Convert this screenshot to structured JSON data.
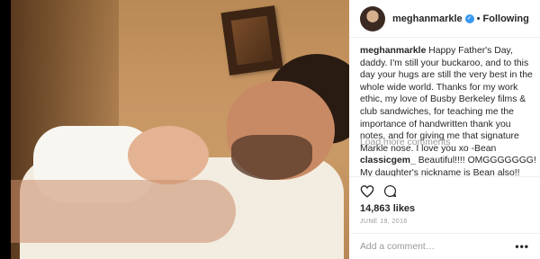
{
  "post": {
    "username": "meghanmarkle",
    "separator": "•",
    "follow_label": "Following",
    "caption_text": "Happy Father's Day, daddy. I'm still your buckaroo, and to this day your hugs are still the very best in the whole wide world. Thanks for my work ethic, my love of Busby Berkeley films & club sandwiches, for teaching me the importance of handwritten thank you notes, and for giving me that signature Markle nose. I love you xo -Bean",
    "load_more": "Load more comments",
    "comments": [
      {
        "user": "classicgem_",
        "text": "Beautiful!!!! OMGGGGGGG! My daughter's nickname is Bean also!!"
      }
    ],
    "likes": "14,863 likes",
    "date": "JUNE 19, 2016",
    "add_comment_placeholder": "Add a comment…",
    "more_glyph": "•••"
  },
  "icons": {
    "like": "heart-icon",
    "comment": "comment-icon",
    "verified": "verified-badge-icon"
  },
  "colors": {
    "verified": "#3897f0",
    "muted": "#999999",
    "text": "#262626"
  }
}
